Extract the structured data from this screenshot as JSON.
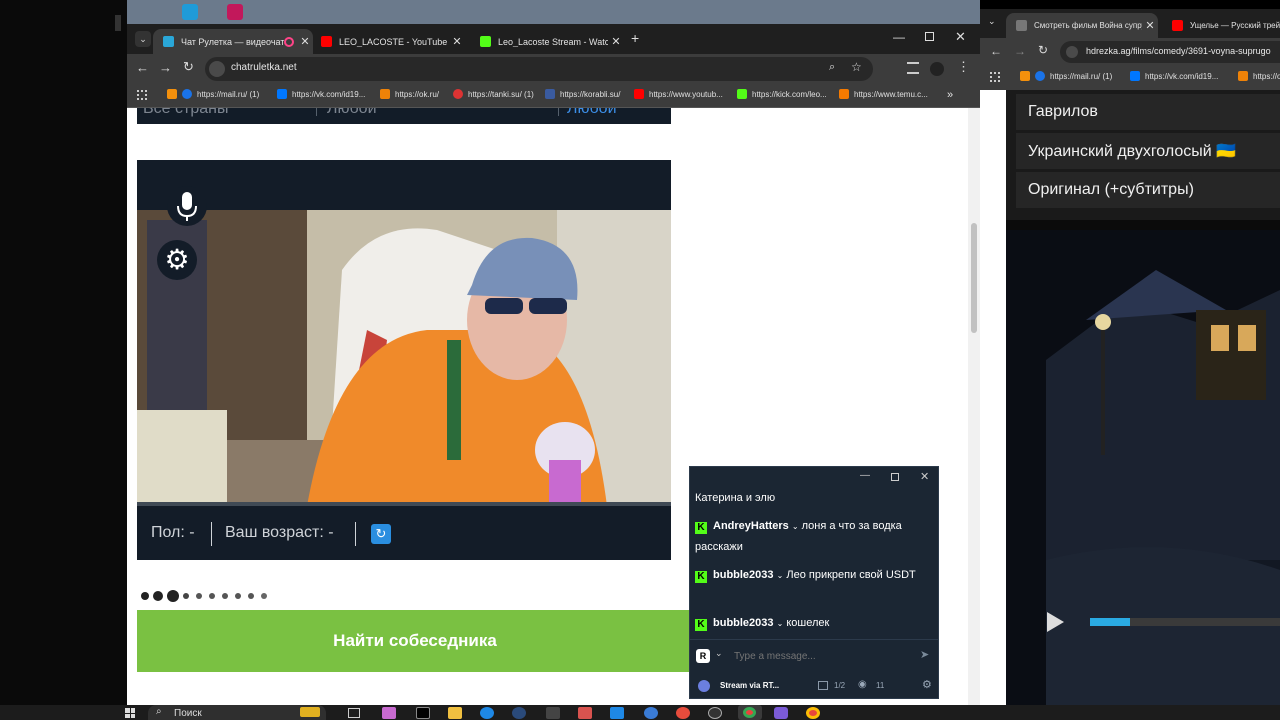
{
  "left_browser": {
    "tabs": [
      {
        "title": "Чат Рулетка — видеочат на",
        "active": true,
        "favicon": "chrome-favicon-icon"
      },
      {
        "title": "LEO_LACOSTE - YouTube",
        "active": false,
        "favicon": "youtube-favicon-icon"
      },
      {
        "title": "Leo_Lacoste Stream - Watch Li",
        "active": false,
        "favicon": "kick-favicon-icon"
      }
    ],
    "url": "chatruletka.net",
    "bookmarks": [
      {
        "label": "https://mail.ru/ (1)",
        "color": "#1a73e8"
      },
      {
        "label": "https://vk.com/id19...",
        "color": "#0077ff"
      },
      {
        "label": "https://ok.ru/",
        "color": "#ee8208"
      },
      {
        "label": "https://tanki.su/ (1)",
        "color": "#d33"
      },
      {
        "label": "https://korabli.su/",
        "color": "#3a5ba0"
      },
      {
        "label": "https://www.youtub...",
        "color": "#ff0000"
      },
      {
        "label": "https://kick.com/leo...",
        "color": "#53fc18"
      },
      {
        "label": "https://www.temu.c...",
        "color": "#f57a00"
      }
    ]
  },
  "page": {
    "filters": {
      "country": "Все страны",
      "gender": "Любой",
      "age": "Любой"
    },
    "info": {
      "gender": "Пол: -",
      "age": "Ваш возраст: -"
    },
    "find_button": "Найти собеседника"
  },
  "chat": {
    "first_line": "Катерина и элю",
    "messages": [
      {
        "user": "AndreyHatters",
        "text": "лоня а что за водка расскажи"
      },
      {
        "user": "bubble2033",
        "text": "Лео прикрепи свой USDT"
      },
      {
        "user": "bubble2033",
        "text": "кошелек"
      }
    ],
    "input_placeholder": "Type a message...",
    "footer_label": "Stream via RT...",
    "page_count": "1/2",
    "viewers": "11"
  },
  "right_browser": {
    "tabs": [
      {
        "title": "Смотреть фильм Война супру",
        "active": true
      },
      {
        "title": "Ущелье — Русский трей",
        "active": false
      }
    ],
    "url": "hdrezka.ag/films/comedy/3691-voyna-suprugo",
    "bookmarks": [
      "https://mail.ru/ (1)",
      "https://vk.com/id19...",
      "https://o"
    ],
    "translations": [
      "Гаврилов",
      "Украинский двухголосый 🇺🇦",
      "Оригинал (+субтитры)"
    ]
  },
  "taskbar": {
    "search_placeholder": "Поиск"
  }
}
